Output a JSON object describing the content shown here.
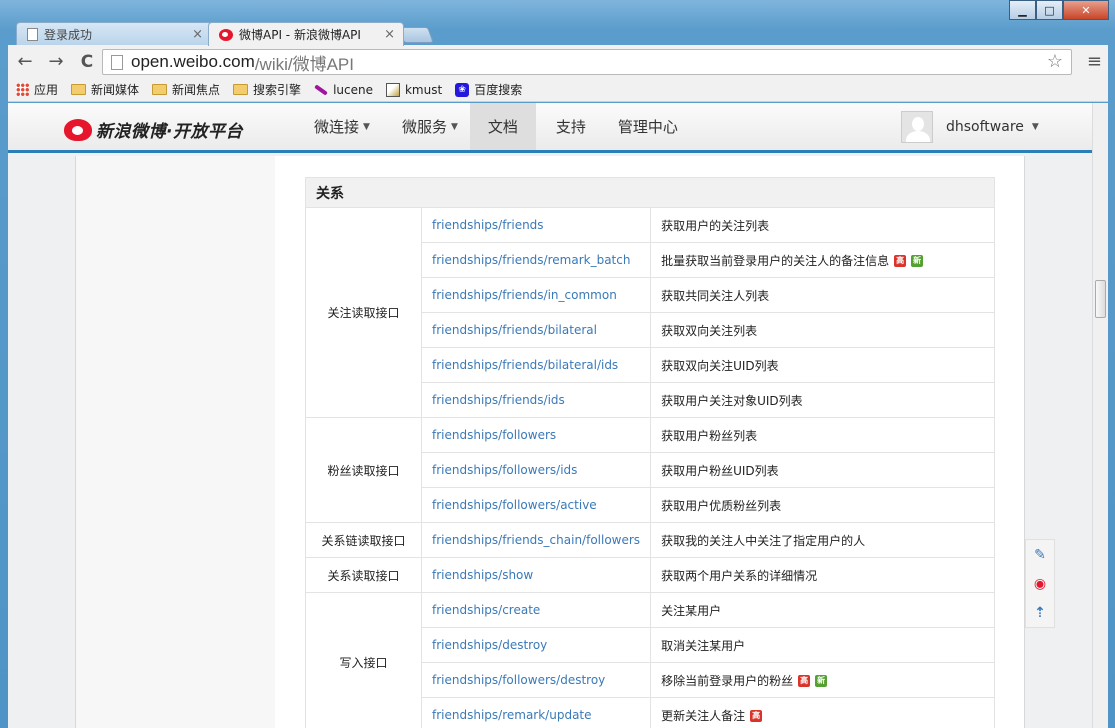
{
  "window": {
    "minimize_label": "▁",
    "maximize_label": "□",
    "close_label": "✕"
  },
  "tabs": [
    {
      "title": "登录成功",
      "close": "×"
    },
    {
      "title": "微博API - 新浪微博API",
      "close": "×"
    }
  ],
  "toolbar": {
    "back": "←",
    "forward": "→",
    "reload": "C",
    "url_host": "open.weibo.com",
    "url_path": "/wiki/微博API",
    "star": "☆",
    "menu": "≡"
  },
  "bookmarks": [
    {
      "label": "应用",
      "icon": "apps-grid-icon"
    },
    {
      "label": "新闻媒体",
      "icon": "folder-icon"
    },
    {
      "label": "新闻焦点",
      "icon": "folder-icon"
    },
    {
      "label": "搜索引擎",
      "icon": "folder-icon"
    },
    {
      "label": "lucene",
      "icon": "lucene-feather-icon"
    },
    {
      "label": "kmust",
      "icon": "kmust-icon"
    },
    {
      "label": "百度搜索",
      "icon": "baidu-paw-icon"
    }
  ],
  "site": {
    "logo_text": "新浪微博·开放平台",
    "nav": [
      {
        "label": "微连接",
        "caret": "▼"
      },
      {
        "label": "微服务",
        "caret": "▼"
      },
      {
        "label": "文档"
      },
      {
        "label": "支持"
      },
      {
        "label": "管理中心"
      }
    ],
    "user_name": "dhsoftware",
    "user_caret": "▼"
  },
  "section": {
    "title": "关系"
  },
  "api_groups": [
    {
      "group": "关注读取接口",
      "rows": [
        {
          "endpoint": "friendships/friends",
          "desc": "获取用户的关注列表",
          "badges": []
        },
        {
          "endpoint": "friendships/friends/remark_batch",
          "desc": "批量获取当前登录用户的关注人的备注信息",
          "badges": [
            "高",
            "新"
          ]
        },
        {
          "endpoint": "friendships/friends/in_common",
          "desc": "获取共同关注人列表",
          "badges": []
        },
        {
          "endpoint": "friendships/friends/bilateral",
          "desc": "获取双向关注列表",
          "badges": []
        },
        {
          "endpoint": "friendships/friends/bilateral/ids",
          "desc": "获取双向关注UID列表",
          "badges": []
        },
        {
          "endpoint": "friendships/friends/ids",
          "desc": "获取用户关注对象UID列表",
          "badges": []
        }
      ]
    },
    {
      "group": "粉丝读取接口",
      "rows": [
        {
          "endpoint": "friendships/followers",
          "desc": "获取用户粉丝列表",
          "badges": []
        },
        {
          "endpoint": "friendships/followers/ids",
          "desc": "获取用户粉丝UID列表",
          "badges": []
        },
        {
          "endpoint": "friendships/followers/active",
          "desc": "获取用户优质粉丝列表",
          "badges": []
        }
      ]
    },
    {
      "group": "关系链读取接口",
      "rows": [
        {
          "endpoint": "friendships/friends_chain/followers",
          "desc": "获取我的关注人中关注了指定用户的人",
          "badges": []
        }
      ]
    },
    {
      "group": "关系读取接口",
      "rows": [
        {
          "endpoint": "friendships/show",
          "desc": "获取两个用户关系的详细情况",
          "badges": []
        }
      ]
    },
    {
      "group": "写入接口",
      "rows": [
        {
          "endpoint": "friendships/create",
          "desc": "关注某用户",
          "badges": []
        },
        {
          "endpoint": "friendships/destroy",
          "desc": "取消关注某用户",
          "badges": []
        },
        {
          "endpoint": "friendships/followers/destroy",
          "desc": "移除当前登录用户的粉丝",
          "badges": [
            "高",
            "新"
          ]
        },
        {
          "endpoint": "friendships/remark/update",
          "desc": "更新关注人备注",
          "badges": [
            "高"
          ]
        }
      ]
    }
  ],
  "float_tools": [
    {
      "name": "feedback-edit-icon",
      "glyph": "✎"
    },
    {
      "name": "weibo-share-icon",
      "glyph": "◉"
    },
    {
      "name": "back-to-top-icon",
      "glyph": "⇡"
    }
  ]
}
